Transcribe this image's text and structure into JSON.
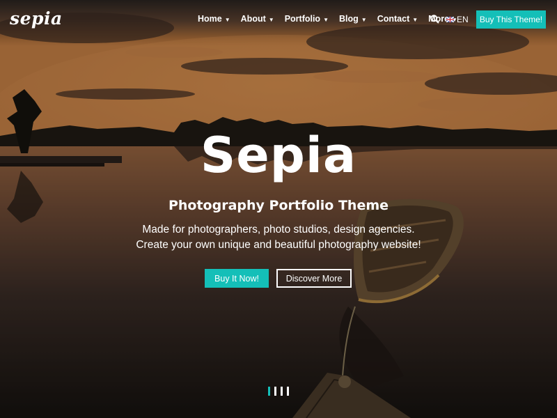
{
  "header": {
    "logo": "sepia",
    "nav": [
      {
        "label": "Home",
        "icon": "chevron-down-icon"
      },
      {
        "label": "About",
        "icon": "chevron-down-icon"
      },
      {
        "label": "Portfolio",
        "icon": "chevron-down-icon"
      },
      {
        "label": "Blog",
        "icon": "chevron-down-icon"
      },
      {
        "label": "Contact",
        "icon": "chevron-down-icon"
      },
      {
        "label": "More",
        "icon": "chevron-down-icon"
      }
    ],
    "search_icon": "search-icon",
    "language": {
      "flag": "uk-flag-icon",
      "label": "EN"
    },
    "cta_label": "Buy This Theme!"
  },
  "hero": {
    "title": "Sepia",
    "subtitle": "Photography Portfolio Theme",
    "description_line1": "Made for photographers, photo studios, design agencies.",
    "description_line2": "Create your own unique and beautiful photography website!",
    "primary_button": "Buy It Now!",
    "secondary_button": "Discover More"
  },
  "slider": {
    "slides": 4,
    "active_index": 0
  },
  "colors": {
    "accent": "#14bfb8",
    "text": "#ffffff"
  }
}
